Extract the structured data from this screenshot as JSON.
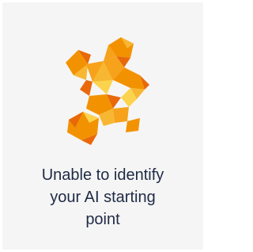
{
  "card": {
    "message": "Unable to identify\nyour AI starting\npoint",
    "illustration_icon": "low-poly-puzzle-icon",
    "colors": {
      "background": "#f5f5f5",
      "text": "#1f2a44",
      "orange_dark": "#e8680a",
      "orange": "#f39200",
      "orange_light": "#f7b733",
      "yellow": "#fcd34d"
    }
  }
}
